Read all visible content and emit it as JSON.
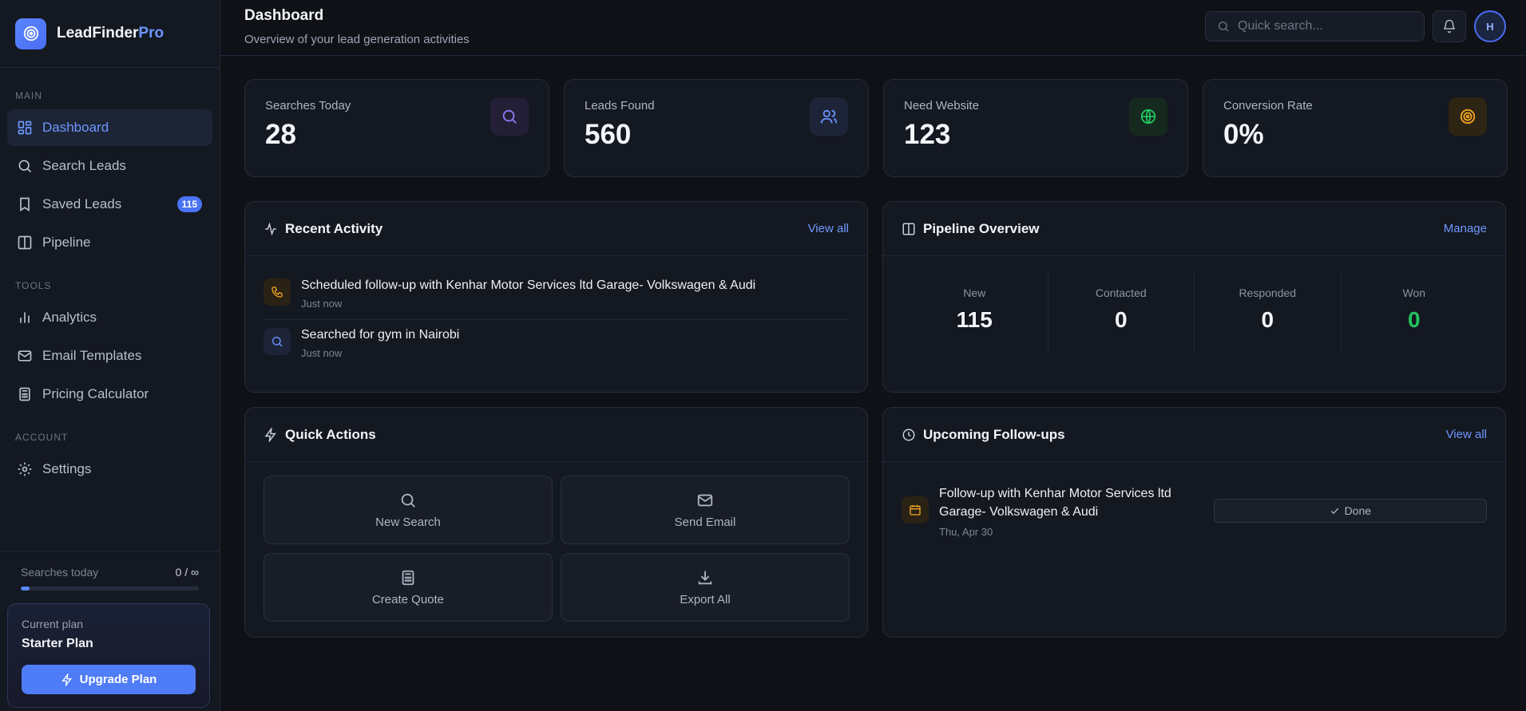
{
  "brand": {
    "name": "LeadFinder",
    "suffix": "Pro"
  },
  "sidebar": {
    "sections": [
      {
        "title": "MAIN"
      },
      {
        "title": "TOOLS"
      },
      {
        "title": "ACCOUNT"
      }
    ],
    "items": [
      {
        "label": "Dashboard",
        "icon": "grid-icon",
        "active": true
      },
      {
        "label": "Search Leads",
        "icon": "search-icon"
      },
      {
        "label": "Saved Leads",
        "icon": "bookmark-icon",
        "badge": "115"
      },
      {
        "label": "Pipeline",
        "icon": "columns-icon"
      },
      {
        "label": "Analytics",
        "icon": "bar-chart-icon"
      },
      {
        "label": "Email Templates",
        "icon": "mail-icon"
      },
      {
        "label": "Pricing Calculator",
        "icon": "calculator-icon"
      },
      {
        "label": "Settings",
        "icon": "gear-icon"
      }
    ],
    "usage": {
      "label": "Searches today",
      "count": "0 / ∞",
      "progress_fraction": 0.05
    },
    "plan": {
      "label": "Current plan",
      "name": "Starter Plan",
      "upgrade_label": "Upgrade Plan"
    }
  },
  "header": {
    "title": "Dashboard",
    "subtitle": "Overview of your lead generation activities",
    "search_placeholder": "Quick search...",
    "avatar_initial": "H"
  },
  "stats": [
    {
      "label": "Searches Today",
      "value": "28",
      "icon": "search-icon",
      "color": "#8b7cf6",
      "bg": "#221f36"
    },
    {
      "label": "Leads Found",
      "value": "560",
      "icon": "users-icon",
      "color": "#6b95ff",
      "bg": "#1d2438"
    },
    {
      "label": "Need Website",
      "value": "123",
      "icon": "globe-icon",
      "color": "#22c55e",
      "bg": "#15291f"
    },
    {
      "label": "Conversion Rate",
      "value": "0%",
      "icon": "target-icon",
      "color": "#f5a623",
      "bg": "#2e2414"
    }
  ],
  "recent_activity": {
    "title": "Recent Activity",
    "link": "View all",
    "items": [
      {
        "text": "Scheduled follow-up with Kenhar Motor Services ltd Garage- Volkswagen & Audi",
        "time": "Just now",
        "icon": "phone-icon"
      },
      {
        "text": "Searched for gym in Nairobi",
        "time": "Just now",
        "icon": "search-icon"
      }
    ]
  },
  "pipeline": {
    "title": "Pipeline Overview",
    "link": "Manage",
    "stages": [
      {
        "label": "New",
        "value": "115",
        "color": "#f2f4f8"
      },
      {
        "label": "Contacted",
        "value": "0",
        "color": "#f2f4f8"
      },
      {
        "label": "Responded",
        "value": "0",
        "color": "#f2f4f8"
      },
      {
        "label": "Won",
        "value": "0",
        "color": "#22c55e"
      }
    ]
  },
  "quick_actions": {
    "title": "Quick Actions",
    "items": [
      {
        "label": "New Search",
        "icon": "search-icon"
      },
      {
        "label": "Send Email",
        "icon": "mail-icon"
      },
      {
        "label": "Create Quote",
        "icon": "calculator-icon"
      },
      {
        "label": "Export All",
        "icon": "download-icon"
      }
    ]
  },
  "followups": {
    "title": "Upcoming Follow-ups",
    "link": "View all",
    "items": [
      {
        "text": "Follow-up with Kenhar Motor Services ltd Garage- Volkswagen & Audi",
        "date": "Thu, Apr 30",
        "action": "Done"
      }
    ]
  }
}
